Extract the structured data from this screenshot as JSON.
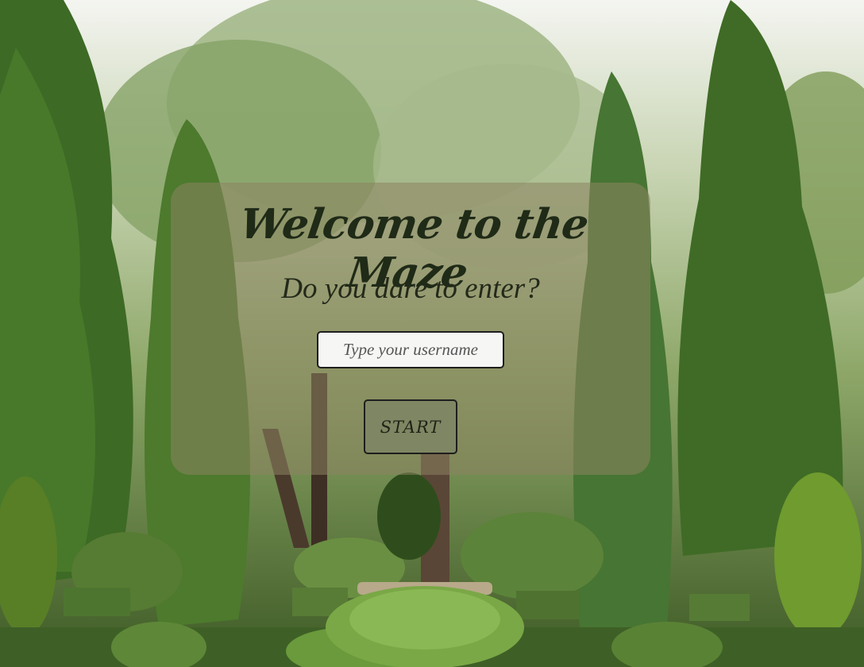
{
  "page": {
    "title": "Welcome to the Maze",
    "subtitle": "Do you dare to enter?"
  },
  "login": {
    "username_placeholder": "Type your username",
    "username_value": "",
    "start_label": "START"
  },
  "colors": {
    "panel_overlay": "rgba(140,132,96,0.55)",
    "button_bg": "#7f8663",
    "text_dark": "#1f2a17",
    "input_bg": "#f6f6f4"
  },
  "background": {
    "description_icon": "garden-maze-background"
  }
}
